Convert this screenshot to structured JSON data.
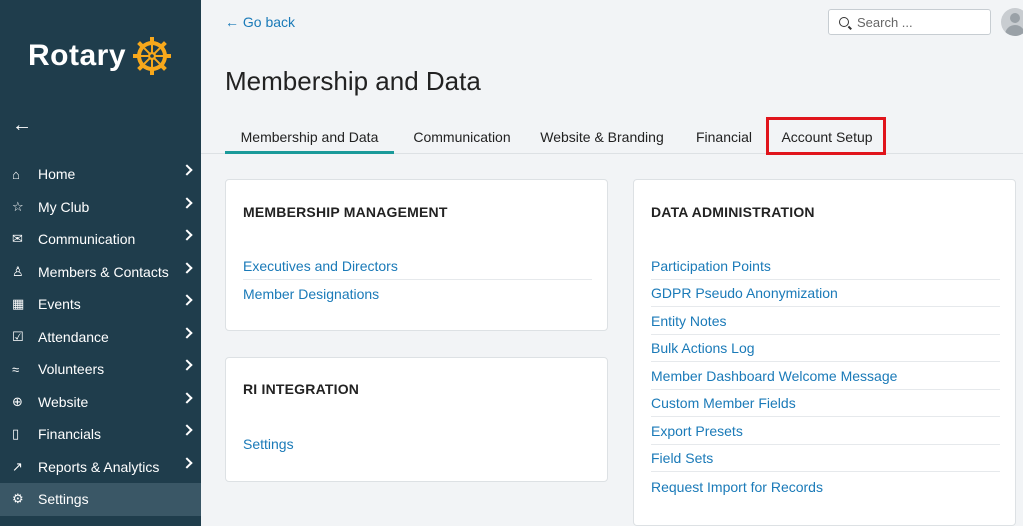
{
  "sidebar": {
    "logo_text": "Rotary",
    "items": [
      {
        "icon": "⌂",
        "label": "Home"
      },
      {
        "icon": "☆",
        "label": "My Club"
      },
      {
        "icon": "✉",
        "label": "Communication"
      },
      {
        "icon": "♙",
        "label": "Members & Contacts"
      },
      {
        "icon": "▦",
        "label": "Events"
      },
      {
        "icon": "☑",
        "label": "Attendance"
      },
      {
        "icon": "≈",
        "label": "Volunteers"
      },
      {
        "icon": "⊕",
        "label": "Website"
      },
      {
        "icon": "▯",
        "label": "Financials"
      },
      {
        "icon": "↗",
        "label": "Reports & Analytics"
      },
      {
        "icon": "⚙",
        "label": "Settings"
      }
    ]
  },
  "topbar": {
    "go_back": "← Go back",
    "search_placeholder": "Search ..."
  },
  "page": {
    "title": "Membership and Data"
  },
  "tabs": [
    {
      "label": "Membership and Data"
    },
    {
      "label": "Communication"
    },
    {
      "label": "Website & Branding"
    },
    {
      "label": "Financial"
    },
    {
      "label": "Account Setup"
    }
  ],
  "cards": {
    "membership": {
      "title": "MEMBERSHIP MANAGEMENT",
      "links": [
        "Executives and Directors",
        "Member Designations"
      ]
    },
    "ri": {
      "title": "RI INTEGRATION",
      "links": [
        "Settings"
      ]
    },
    "data_admin": {
      "title": "DATA ADMINISTRATION",
      "links": [
        "Participation Points",
        "GDPR Pseudo Anonymization",
        "Entity Notes",
        "Bulk Actions Log",
        "Member Dashboard Welcome Message",
        "Custom Member Fields",
        "Export Presets",
        "Field Sets",
        "Request Import for Records"
      ]
    }
  },
  "colors": {
    "sidebar_bg": "#1f3d4c",
    "link": "#1a7ab8",
    "tab_active": "#1a9a9a",
    "highlight_box": "#e0141b",
    "logo_gold": "#f7a81b"
  }
}
